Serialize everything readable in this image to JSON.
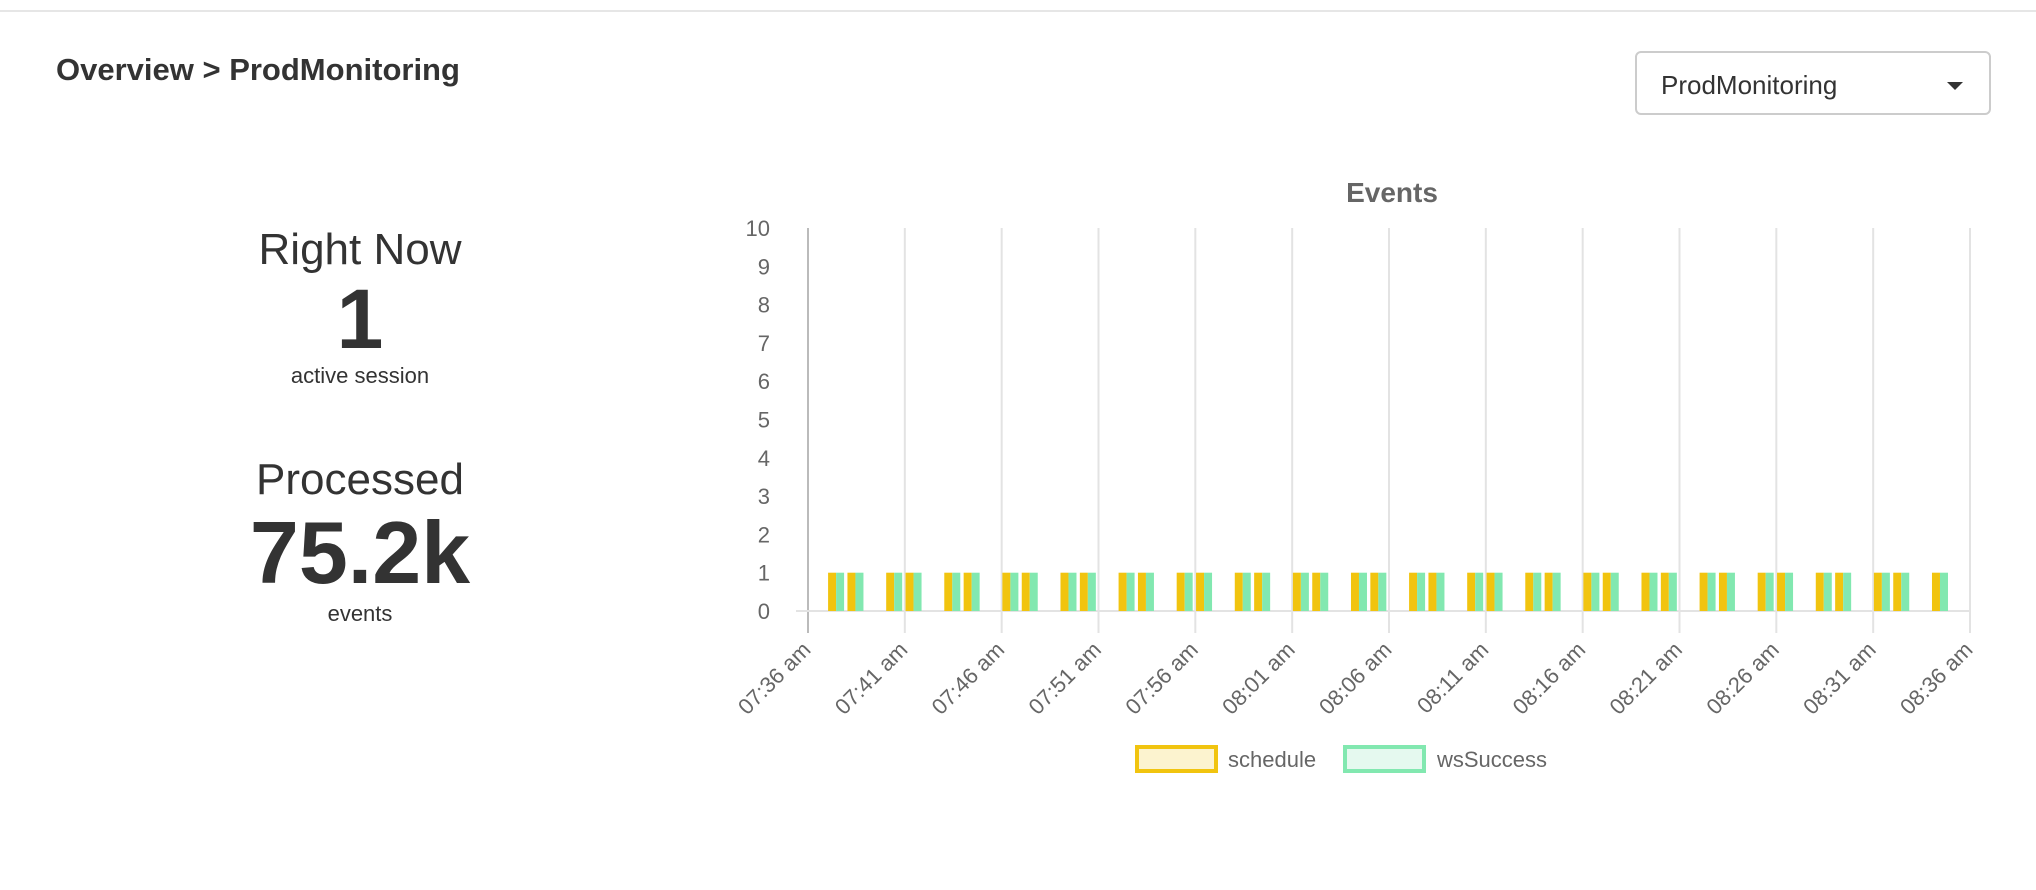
{
  "breadcrumb": "Overview > ProdMonitoring",
  "selector": {
    "selected": "ProdMonitoring",
    "icon": "caret-down-icon"
  },
  "right_now": {
    "heading": "Right Now",
    "value": "1",
    "unit": "active session"
  },
  "processed": {
    "heading": "Processed",
    "value": "75.2k",
    "unit": "events"
  },
  "chart_data": {
    "type": "bar",
    "title": "Events",
    "xlabel": "",
    "ylabel": "",
    "ylim": [
      0,
      10
    ],
    "yticks": [
      "0",
      "1",
      "2",
      "3",
      "4",
      "5",
      "6",
      "7",
      "8",
      "9",
      "10"
    ],
    "xticks": [
      "07:36 am",
      "07:41 am",
      "07:46 am",
      "07:51 am",
      "07:56 am",
      "08:01 am",
      "08:06 am",
      "08:11 am",
      "08:16 am",
      "08:21 am",
      "08:26 am",
      "08:31 am",
      "08:36 am"
    ],
    "x": [
      "07:37",
      "07:38",
      "07:40",
      "07:41",
      "07:43",
      "07:44",
      "07:46",
      "07:47",
      "07:49",
      "07:50",
      "07:52",
      "07:53",
      "07:55",
      "07:56",
      "07:58",
      "07:59",
      "08:01",
      "08:02",
      "08:04",
      "08:05",
      "08:07",
      "08:08",
      "08:10",
      "08:11",
      "08:13",
      "08:14",
      "08:16",
      "08:17",
      "08:19",
      "08:20",
      "08:22",
      "08:23",
      "08:25",
      "08:26",
      "08:28",
      "08:29",
      "08:31",
      "08:32",
      "08:34"
    ],
    "series": [
      {
        "name": "schedule",
        "color": "#f1c40f",
        "fill": "#fcf3cf",
        "values": [
          1,
          1,
          1,
          1,
          1,
          1,
          1,
          1,
          1,
          1,
          1,
          1,
          1,
          1,
          1,
          1,
          1,
          1,
          1,
          1,
          1,
          1,
          1,
          1,
          1,
          1,
          1,
          1,
          1,
          1,
          1,
          1,
          1,
          1,
          1,
          1,
          1,
          1,
          1
        ]
      },
      {
        "name": "wsSuccess",
        "color": "#82e8b0",
        "fill": "#e5f9ef",
        "values": [
          1,
          1,
          1,
          1,
          1,
          1,
          1,
          1,
          1,
          1,
          1,
          1,
          1,
          1,
          1,
          1,
          1,
          1,
          1,
          1,
          1,
          1,
          1,
          1,
          1,
          1,
          1,
          1,
          1,
          1,
          1,
          1,
          1,
          1,
          1,
          1,
          1,
          1,
          1
        ]
      }
    ],
    "grid": "vertical",
    "legend": "bottom"
  }
}
